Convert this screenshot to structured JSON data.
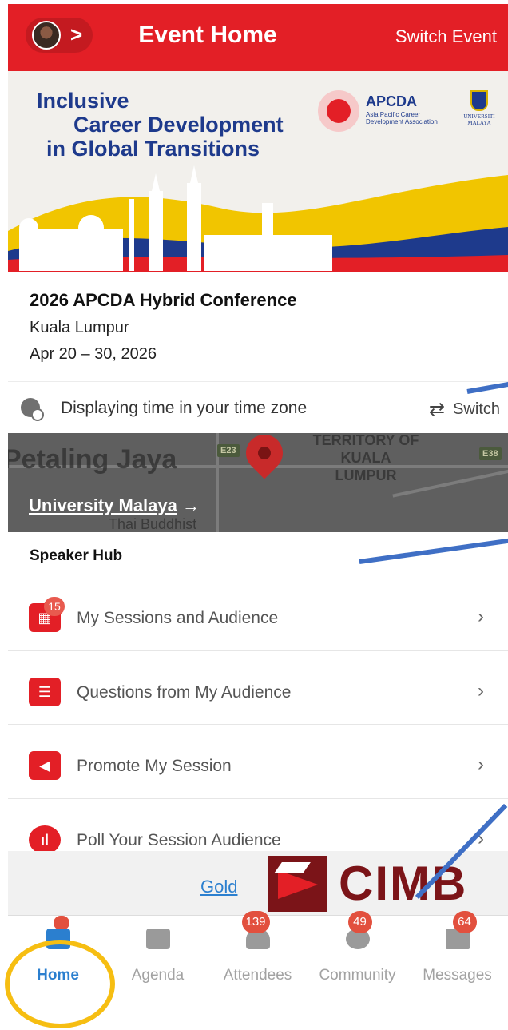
{
  "header": {
    "title": "Event Home",
    "switch_event": "Switch Event",
    "profile_chevron": ">"
  },
  "banner": {
    "line1": "Inclusive",
    "line2": "Career Development",
    "line3": "in Global Transitions",
    "logo_apcda": "APCDA",
    "logo_apcda_sub": "Asia Pacific Career Development Association",
    "logo_um": "UNIVERSITI MALAYA"
  },
  "event": {
    "name": "2026 APCDA Hybrid Conference",
    "city": "Kuala Lumpur",
    "dates": "Apr 20 – 30, 2026"
  },
  "timezone": {
    "text": "Displaying time in your time zone",
    "switch_label": "Switch"
  },
  "map": {
    "label_pj": "Petaling Jaya",
    "label_kl": "TERRITORY OF KUALA LUMPUR",
    "label_thai": "Thai Buddhist",
    "road_e23": "E23",
    "road_e38": "E38",
    "link": "University Malaya",
    "link_arrow": "→"
  },
  "speaker_hub": {
    "title": "Speaker Hub",
    "items": [
      {
        "label": "My Sessions and Audience",
        "icon": "calendar-icon",
        "badge": "15"
      },
      {
        "label": "Questions from My Audience",
        "icon": "question-list-icon",
        "badge": ""
      },
      {
        "label": "Promote My Session",
        "icon": "megaphone-icon",
        "badge": ""
      },
      {
        "label": "Poll Your Session Audience",
        "icon": "poll-icon",
        "badge": ""
      }
    ],
    "chevron": "›"
  },
  "sponsor": {
    "tier": "Gold",
    "name": "CIMB"
  },
  "tabbar": {
    "tabs": [
      {
        "label": "Home",
        "icon": "home-icon",
        "badge": "",
        "active": true
      },
      {
        "label": "Agenda",
        "icon": "calendar-grid-icon",
        "badge": "",
        "active": false
      },
      {
        "label": "Attendees",
        "icon": "people-icon",
        "badge": "139",
        "active": false
      },
      {
        "label": "Community",
        "icon": "chat-bubbles-icon",
        "badge": "49",
        "active": false
      },
      {
        "label": "Messages",
        "icon": "envelope-icon",
        "badge": "64",
        "active": false
      }
    ]
  },
  "colors": {
    "brand_red": "#e31f26",
    "active_blue": "#2b7fcf",
    "annotation_yellow": "#f6be12",
    "annotation_blue": "#3f6fc5"
  }
}
